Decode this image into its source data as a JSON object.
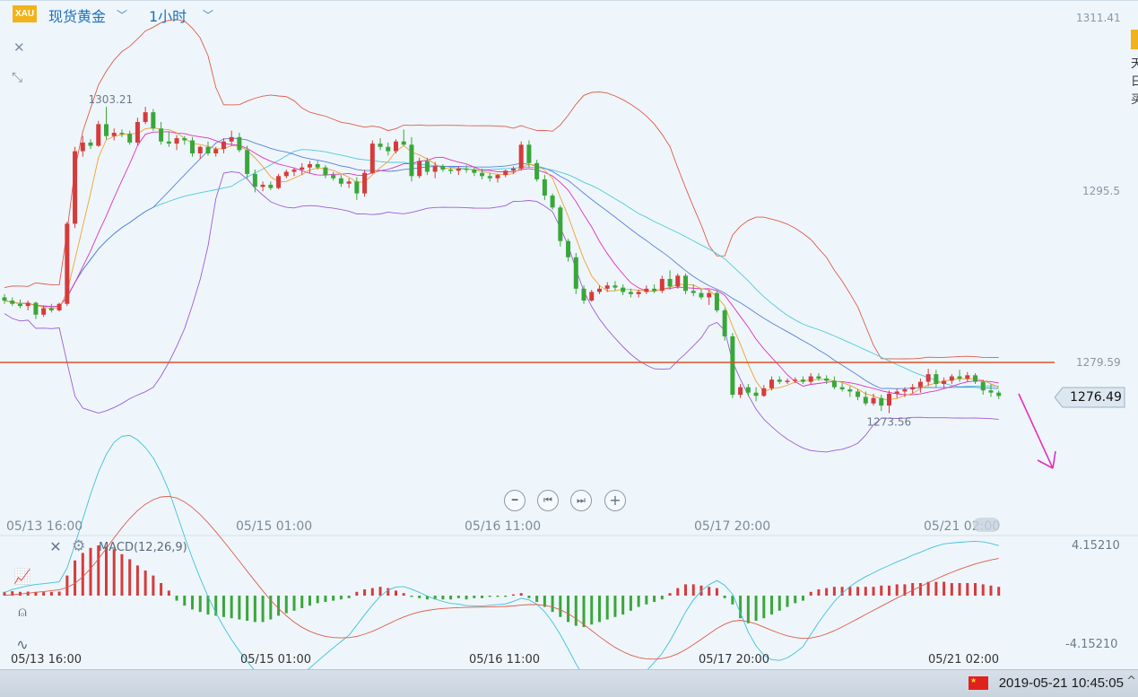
{
  "header": {
    "badge": "XAU",
    "symbol": "现货黄金",
    "timeframe": "1小时"
  },
  "colors": {
    "up": "#d63b3b",
    "down": "#3aa63a",
    "upper_band": "#e05a4a",
    "lower_band": "#a05ad8",
    "ma5": "#f0a030",
    "ma10": "#e030c0",
    "ma20": "#5a80d8",
    "ma30": "#50c8d8",
    "support": "#e0502a",
    "arrow": "#e030c0",
    "hist_pos": "#d63b3b",
    "hist_neg": "#3aa63a",
    "dif": "#40c0d8",
    "dea": "#e05a4a"
  },
  "price_axis": {
    "top": "1311.41",
    "mid": "1295.5",
    "lower": "1279.59"
  },
  "current_price": "1276.49",
  "annotations": {
    "high": "1303.21",
    "low": "1273.56"
  },
  "x_labels": [
    "05/13 16:00",
    "05/15 01:00",
    "05/16 11:00",
    "05/17 20:00",
    "05/21 02:00"
  ],
  "macd": {
    "label": "MACD(12,26,9)",
    "top": "4.15210",
    "bottom": "-4.15210"
  },
  "statusbar": {
    "datetime": "2019-05-21 10:45:05"
  },
  "chart_data": {
    "type": "candlestick",
    "title": "现货黄金 1小时",
    "ylim": [
      1269.5,
      1311.41
    ],
    "support_level": 1279.59,
    "last": 1276.49,
    "candles": [
      [
        1285.6,
        1285.9,
        1285.0,
        1285.3
      ],
      [
        1285.3,
        1285.6,
        1284.8,
        1285.0
      ],
      [
        1285.0,
        1285.4,
        1284.6,
        1284.8
      ],
      [
        1284.8,
        1285.3,
        1284.4,
        1285.1
      ],
      [
        1285.1,
        1285.2,
        1283.6,
        1284.0
      ],
      [
        1284.0,
        1284.8,
        1283.8,
        1284.6
      ],
      [
        1284.6,
        1285.0,
        1284.2,
        1284.4
      ],
      [
        1284.4,
        1285.1,
        1284.3,
        1285.0
      ],
      [
        1285.0,
        1292.6,
        1284.8,
        1292.4
      ],
      [
        1292.4,
        1299.5,
        1292.0,
        1299.1
      ],
      [
        1299.1,
        1300.5,
        1298.6,
        1299.9
      ],
      [
        1299.9,
        1300.2,
        1299.3,
        1299.6
      ],
      [
        1299.6,
        1301.9,
        1299.5,
        1301.6
      ],
      [
        1301.6,
        1303.2,
        1300.2,
        1300.5
      ],
      [
        1300.5,
        1301.2,
        1300.1,
        1300.8
      ],
      [
        1300.8,
        1301.1,
        1300.4,
        1300.7
      ],
      [
        1300.7,
        1301.0,
        1299.7,
        1299.9
      ],
      [
        1299.9,
        1302.2,
        1299.6,
        1301.8
      ],
      [
        1301.8,
        1303.2,
        1301.6,
        1302.7
      ],
      [
        1302.7,
        1303.0,
        1301.0,
        1301.2
      ],
      [
        1301.2,
        1301.8,
        1299.7,
        1300.0
      ],
      [
        1300.0,
        1300.9,
        1299.5,
        1299.8
      ],
      [
        1299.8,
        1300.6,
        1299.2,
        1300.3
      ],
      [
        1300.3,
        1300.5,
        1299.7,
        1300.1
      ],
      [
        1300.1,
        1300.4,
        1298.6,
        1298.9
      ],
      [
        1298.9,
        1299.6,
        1298.4,
        1299.5
      ],
      [
        1299.5,
        1300.0,
        1298.7,
        1298.9
      ],
      [
        1298.9,
        1299.5,
        1298.6,
        1299.3
      ],
      [
        1299.3,
        1300.3,
        1298.9,
        1300.0
      ],
      [
        1300.0,
        1301.0,
        1299.6,
        1300.4
      ],
      [
        1300.4,
        1300.8,
        1299.0,
        1299.2
      ],
      [
        1299.2,
        1299.6,
        1296.6,
        1297.0
      ],
      [
        1297.0,
        1297.4,
        1295.3,
        1295.8
      ],
      [
        1295.8,
        1296.3,
        1295.4,
        1296.0
      ],
      [
        1296.0,
        1296.3,
        1295.5,
        1295.7
      ],
      [
        1295.7,
        1297.0,
        1295.6,
        1296.8
      ],
      [
        1296.8,
        1297.4,
        1296.6,
        1297.2
      ],
      [
        1297.2,
        1297.6,
        1296.8,
        1297.4
      ],
      [
        1297.4,
        1298.0,
        1296.9,
        1297.6
      ],
      [
        1297.6,
        1298.2,
        1297.1,
        1297.9
      ],
      [
        1297.9,
        1298.2,
        1297.4,
        1297.6
      ],
      [
        1297.6,
        1297.8,
        1296.6,
        1296.9
      ],
      [
        1296.9,
        1297.2,
        1296.4,
        1296.6
      ],
      [
        1296.6,
        1296.9,
        1295.8,
        1296.1
      ],
      [
        1296.1,
        1296.6,
        1295.7,
        1296.3
      ],
      [
        1296.3,
        1296.7,
        1294.6,
        1295.2
      ],
      [
        1295.2,
        1297.4,
        1294.9,
        1297.1
      ],
      [
        1297.1,
        1300.1,
        1297.0,
        1299.8
      ],
      [
        1299.8,
        1300.3,
        1299.2,
        1299.5
      ],
      [
        1299.5,
        1299.9,
        1298.7,
        1299.1
      ],
      [
        1299.1,
        1300.2,
        1298.9,
        1300.0
      ],
      [
        1300.0,
        1301.1,
        1299.6,
        1299.7
      ],
      [
        1299.7,
        1300.4,
        1296.3,
        1296.8
      ],
      [
        1296.8,
        1298.5,
        1296.6,
        1298.2
      ],
      [
        1298.2,
        1298.5,
        1296.9,
        1297.2
      ],
      [
        1297.2,
        1298.1,
        1296.6,
        1297.7
      ],
      [
        1297.7,
        1297.9,
        1297.2,
        1297.4
      ],
      [
        1297.4,
        1297.6,
        1297.0,
        1297.3
      ],
      [
        1297.3,
        1297.7,
        1296.9,
        1297.5
      ],
      [
        1297.5,
        1297.8,
        1297.1,
        1297.4
      ],
      [
        1297.4,
        1297.7,
        1296.8,
        1297.1
      ],
      [
        1297.1,
        1297.5,
        1296.5,
        1296.8
      ],
      [
        1296.8,
        1297.1,
        1296.3,
        1296.6
      ],
      [
        1296.6,
        1297.0,
        1296.2,
        1296.9
      ],
      [
        1296.9,
        1297.4,
        1296.7,
        1297.3
      ],
      [
        1297.3,
        1297.7,
        1297.0,
        1297.5
      ],
      [
        1297.5,
        1300.0,
        1297.3,
        1299.7
      ],
      [
        1299.7,
        1300.1,
        1297.6,
        1298.0
      ],
      [
        1298.0,
        1298.3,
        1296.3,
        1296.5
      ],
      [
        1296.5,
        1296.9,
        1294.6,
        1295.0
      ],
      [
        1295.0,
        1295.2,
        1293.7,
        1293.9
      ],
      [
        1293.9,
        1294.1,
        1290.3,
        1290.8
      ],
      [
        1290.8,
        1291.0,
        1288.9,
        1289.3
      ],
      [
        1289.3,
        1289.7,
        1285.9,
        1286.4
      ],
      [
        1286.4,
        1286.7,
        1285.0,
        1285.3
      ],
      [
        1285.3,
        1286.3,
        1285.2,
        1286.1
      ],
      [
        1286.1,
        1286.7,
        1285.9,
        1286.4
      ],
      [
        1286.4,
        1287.0,
        1286.1,
        1286.7
      ],
      [
        1286.7,
        1287.1,
        1286.2,
        1286.5
      ],
      [
        1286.5,
        1286.8,
        1285.8,
        1286.1
      ],
      [
        1286.1,
        1286.4,
        1285.6,
        1285.9
      ],
      [
        1285.9,
        1286.3,
        1285.6,
        1286.1
      ],
      [
        1286.1,
        1286.7,
        1285.9,
        1286.4
      ],
      [
        1286.4,
        1286.8,
        1286.0,
        1286.2
      ],
      [
        1286.2,
        1287.6,
        1286.0,
        1287.3
      ],
      [
        1287.3,
        1288.1,
        1286.3,
        1286.6
      ],
      [
        1286.6,
        1287.8,
        1286.4,
        1287.6
      ],
      [
        1287.6,
        1287.8,
        1285.9,
        1286.2
      ],
      [
        1286.2,
        1286.8,
        1285.7,
        1286.0
      ],
      [
        1286.0,
        1286.4,
        1285.4,
        1285.6
      ],
      [
        1285.6,
        1286.3,
        1284.9,
        1286.0
      ],
      [
        1286.0,
        1286.2,
        1284.2,
        1284.4
      ],
      [
        1284.4,
        1284.6,
        1281.6,
        1282.0
      ],
      [
        1282.0,
        1282.3,
        1276.3,
        1276.6
      ],
      [
        1276.6,
        1277.6,
        1276.3,
        1277.3
      ],
      [
        1277.3,
        1277.6,
        1276.5,
        1276.8
      ],
      [
        1276.8,
        1277.3,
        1276.0,
        1276.5
      ],
      [
        1276.5,
        1277.5,
        1276.4,
        1277.2
      ],
      [
        1277.2,
        1278.3,
        1277.0,
        1278.0
      ],
      [
        1278.0,
        1278.3,
        1277.6,
        1277.8
      ],
      [
        1277.8,
        1278.1,
        1277.6,
        1277.9
      ],
      [
        1277.9,
        1278.2,
        1277.7,
        1278.0
      ],
      [
        1278.0,
        1278.3,
        1277.6,
        1277.8
      ],
      [
        1277.8,
        1278.6,
        1277.6,
        1278.3
      ],
      [
        1278.3,
        1278.6,
        1277.9,
        1278.1
      ],
      [
        1278.1,
        1278.4,
        1277.6,
        1277.9
      ],
      [
        1277.9,
        1278.3,
        1277.1,
        1277.3
      ],
      [
        1277.3,
        1277.7,
        1276.9,
        1277.1
      ],
      [
        1277.1,
        1277.4,
        1276.4,
        1276.9
      ],
      [
        1276.9,
        1277.1,
        1276.1,
        1276.4
      ],
      [
        1276.4,
        1276.9,
        1275.6,
        1275.8
      ],
      [
        1275.8,
        1276.7,
        1275.6,
        1276.3
      ],
      [
        1276.3,
        1276.6,
        1275.1,
        1275.6
      ],
      [
        1275.6,
        1277.0,
        1274.9,
        1276.7
      ],
      [
        1276.7,
        1277.2,
        1276.3,
        1276.9
      ],
      [
        1276.9,
        1277.3,
        1276.4,
        1277.1
      ],
      [
        1277.1,
        1277.6,
        1276.7,
        1277.3
      ],
      [
        1277.3,
        1278.1,
        1276.8,
        1277.8
      ],
      [
        1277.8,
        1279.0,
        1277.4,
        1278.5
      ],
      [
        1278.5,
        1278.9,
        1277.3,
        1277.6
      ],
      [
        1277.6,
        1278.2,
        1277.3,
        1277.9
      ],
      [
        1277.9,
        1278.5,
        1277.6,
        1278.3
      ],
      [
        1278.3,
        1278.9,
        1277.8,
        1278.1
      ],
      [
        1278.1,
        1278.7,
        1277.8,
        1278.4
      ],
      [
        1278.4,
        1278.6,
        1277.6,
        1277.8
      ],
      [
        1277.8,
        1278.0,
        1276.6,
        1277.0
      ],
      [
        1277.0,
        1277.6,
        1276.4,
        1276.8
      ],
      [
        1276.8,
        1277.0,
        1276.2,
        1276.49
      ]
    ],
    "macd_hist": [
      0.3,
      0.35,
      0.3,
      0.32,
      0.3,
      0.28,
      0.3,
      0.32,
      1.6,
      2.8,
      3.4,
      3.8,
      4.0,
      3.9,
      3.7,
      3.3,
      2.9,
      2.4,
      2.0,
      1.6,
      1.0,
      0.4,
      -0.4,
      -0.8,
      -1.1,
      -1.3,
      -1.5,
      -1.6,
      -1.7,
      -1.8,
      -1.9,
      -2.0,
      -2.1,
      -2.1,
      -1.9,
      -1.6,
      -1.4,
      -1.2,
      -1.0,
      -0.8,
      -0.6,
      -0.5,
      -0.4,
      -0.3,
      -0.2,
      0.3,
      0.5,
      0.6,
      0.7,
      0.6,
      0.4,
      0.2,
      -0.1,
      -0.2,
      -0.3,
      -0.3,
      -0.3,
      -0.3,
      -0.2,
      -0.3,
      -0.2,
      -0.2,
      -0.1,
      -0.1,
      -0.1,
      0.1,
      0.2,
      -0.2,
      -0.5,
      -0.9,
      -1.3,
      -1.7,
      -2.1,
      -2.4,
      -2.5,
      -2.3,
      -2.1,
      -1.9,
      -1.7,
      -1.5,
      -1.2,
      -0.9,
      -0.7,
      -0.5,
      -0.3,
      0.2,
      0.6,
      0.9,
      0.9,
      0.8,
      0.7,
      0.6,
      -0.2,
      -0.7,
      -1.8,
      -2.2,
      -2.0,
      -1.8,
      -1.5,
      -1.2,
      -0.9,
      -0.6,
      -0.4,
      0.3,
      0.5,
      0.6,
      0.7,
      0.7,
      0.7,
      0.7,
      0.7,
      0.7,
      0.8,
      0.8,
      0.9,
      0.9,
      1.0,
      1.0,
      1.1,
      1.1,
      1.1,
      1.0,
      1.0,
      1.0,
      1.0,
      0.9,
      0.8,
      0.7
    ]
  }
}
